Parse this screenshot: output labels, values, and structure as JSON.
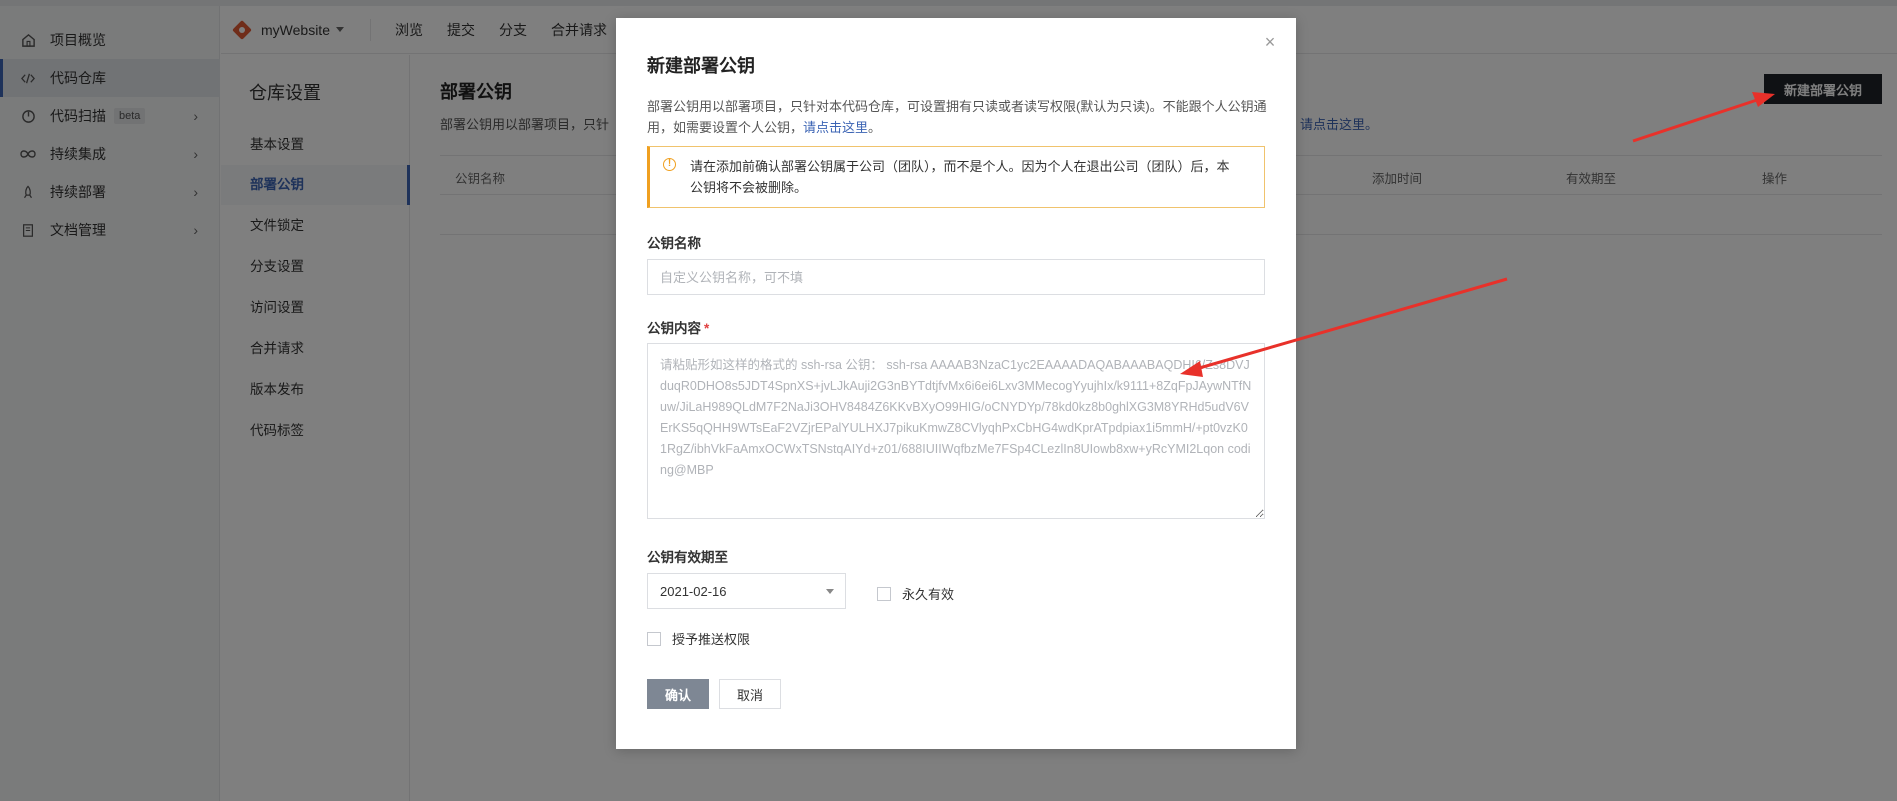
{
  "sidebar": {
    "items": [
      {
        "label": "项目概览",
        "icon": "home-icon"
      },
      {
        "label": "代码仓库",
        "icon": "code-icon"
      },
      {
        "label": "代码扫描",
        "icon": "scan-icon",
        "badge": "beta"
      },
      {
        "label": "持续集成",
        "icon": "infinity-icon"
      },
      {
        "label": "持续部署",
        "icon": "rocket-icon"
      },
      {
        "label": "文档管理",
        "icon": "book-icon"
      }
    ]
  },
  "topnav": {
    "repo_name": "myWebsite",
    "tabs": [
      "浏览",
      "提交",
      "分支",
      "合并请求"
    ]
  },
  "settings": {
    "title": "仓库设置",
    "items": [
      "基本设置",
      "部署公钥",
      "文件锁定",
      "分支设置",
      "访问设置",
      "合并请求",
      "版本发布",
      "代码标签"
    ]
  },
  "main": {
    "title": "部署公钥",
    "desc": "部署公钥用以部署项目，只针",
    "link": "请点击这里。",
    "new_button": "新建部署公钥",
    "columns": [
      "公钥名称",
      "添加时间",
      "有效期至",
      "操作"
    ]
  },
  "modal": {
    "title": "新建部署公钥",
    "close": "×",
    "desc": "部署公钥用以部署项目，只针对本代码仓库，可设置拥有只读或者读写权限(默认为只读)。不能跟个人公钥通用，如需要设置个人公钥，",
    "desc_link": "请点击这里",
    "desc_end": "。",
    "warning": "请在添加前确认部署公钥属于公司（团队），而不是个人。因为个人在退出公司（团队）后，本公钥将不会被删除。",
    "name_label": "公钥名称",
    "name_placeholder": "自定义公钥名称，可不填",
    "content_label": "公钥内容",
    "content_required": "*",
    "content_placeholder": "请粘贴形如这样的格式的 ssh-rsa 公钥： ssh-rsa AAAAB3NzaC1yc2EAAAADAQABAAABAQDHI6/Zs8DVJduqR0DHO8s5JDT4SpnXS+jvLJkAuji2G3nBYTdtjfvMx6i6ei6Lxv3MMecogYyujhIx/k9111+8ZqFpJAywNTfNuw/JiLaH989QLdM7F2NaJi3OHV8484Z6KKvBXyO99HIG/oCNYDYp/78kd0kz8b0ghlXG3M8YRHd5udV6VErKS5qQHH9WTsEaF2VZjrEPalYULHXJ7pikuKmwZ8CVlyqhPxCbHG4wdKprATpdpiax1i5mmH/+pt0vzK01RgZ/ibhVkFaAmxOCWxTSNstqAIYd+z01/688IUIIWqfbzMe7FSp4CLezlIn8UIowb8xw+yRcYMI2Lqon coding@MBP",
    "expire_label": "公钥有效期至",
    "expire_date": "2021-02-16",
    "forever_label": "永久有效",
    "push_label": "授予推送权限",
    "confirm": "确认",
    "cancel": "取消"
  },
  "colors": {
    "accent": "#3c64b4",
    "warning": "#f0a020",
    "annotation_arrow": "#e8312a",
    "dark_button": "#1e2228"
  }
}
